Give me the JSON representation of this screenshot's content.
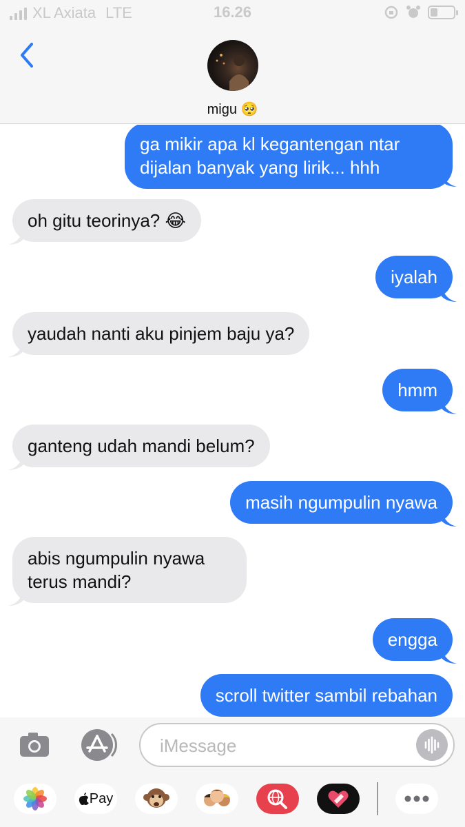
{
  "status_bar": {
    "carrier": "XL Axiata",
    "network": "LTE",
    "time": "16.26"
  },
  "header": {
    "contact_name": "migu 🥺"
  },
  "messages": [
    {
      "direction": "out",
      "text": "ga mikir apa kl kegantengan ntar\ndijalan banyak yang lirik... hhh"
    },
    {
      "direction": "in",
      "text": "oh gitu teorinya? 😂"
    },
    {
      "direction": "out",
      "text": "iyalah"
    },
    {
      "direction": "in",
      "text": "yaudah nanti aku pinjem baju ya?"
    },
    {
      "direction": "out",
      "text": "hmm"
    },
    {
      "direction": "in",
      "text": "ganteng udah mandi belum?"
    },
    {
      "direction": "out",
      "text": "masih ngumpulin nyawa"
    },
    {
      "direction": "in",
      "text": "abis ngumpulin nyawa\nterus mandi?"
    },
    {
      "direction": "out",
      "text": "engga"
    },
    {
      "direction": "out",
      "text": "scroll twitter sambil rebahan"
    }
  ],
  "input_bar": {
    "placeholder": "iMessage"
  },
  "app_drawer": {
    "apple_pay_label": "Pay",
    "apps": [
      "photos-icon",
      "apple-pay-icon",
      "animoji-icon",
      "memoji-icon",
      "web-search-icon",
      "digital-touch-icon",
      "more-icon"
    ]
  },
  "colors": {
    "outgoing_bubble": "#2f7bf5",
    "incoming_bubble": "#e9e9eb",
    "accent": "#2f7bf5"
  }
}
